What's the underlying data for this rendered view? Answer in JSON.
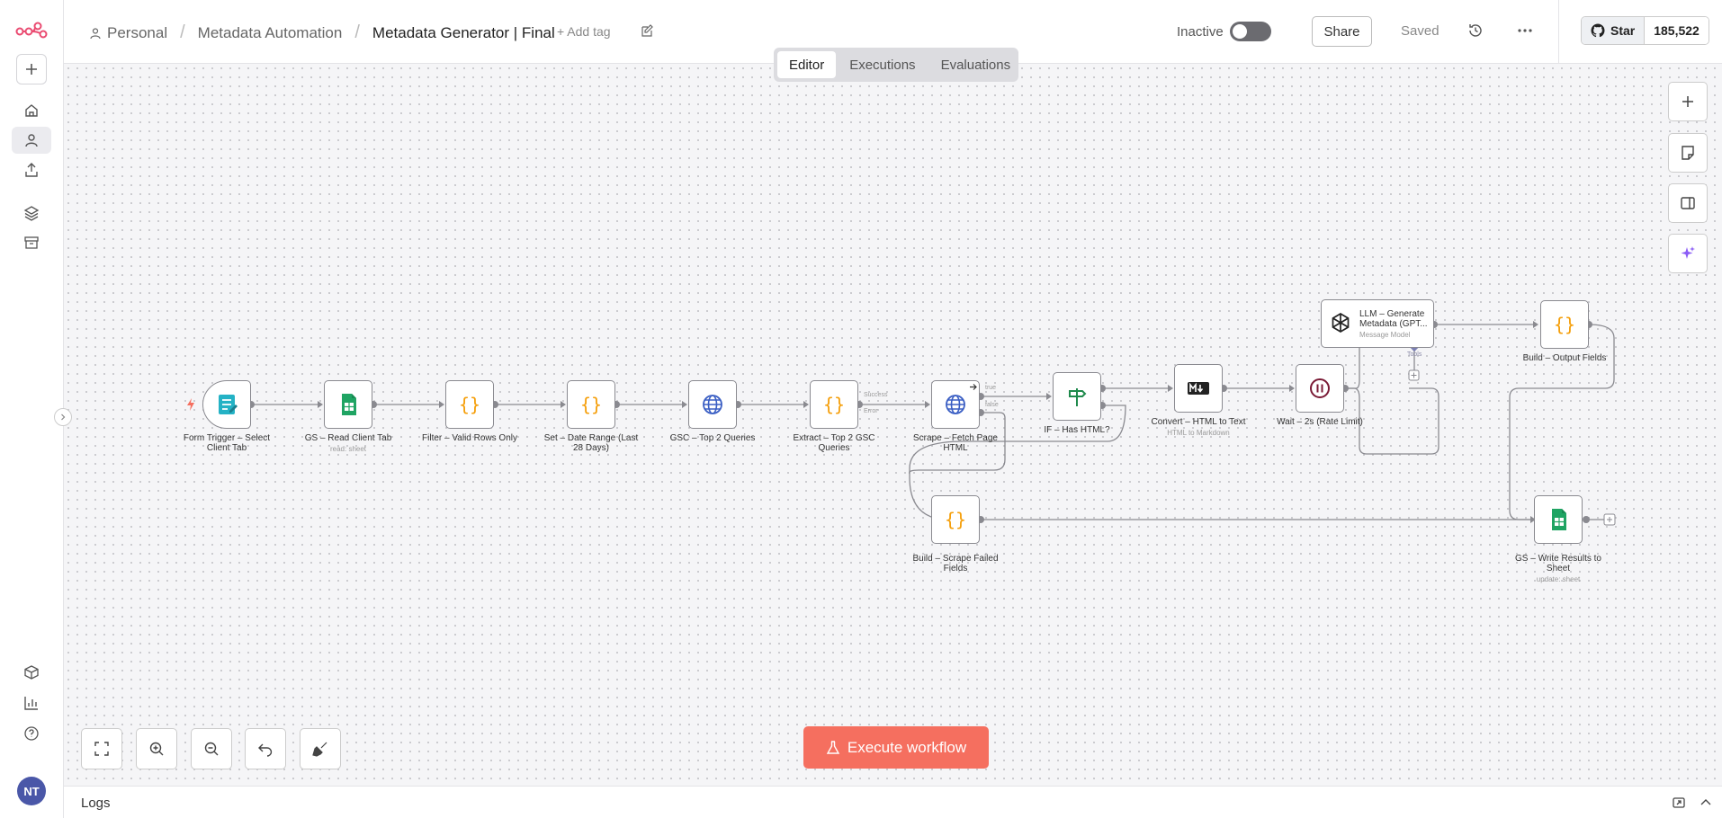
{
  "app": {
    "brand_color": "#ea4b71",
    "accent": "#f56f5f"
  },
  "header": {
    "project": "Personal",
    "folder": "Metadata Automation",
    "workflow_name": "Metadata Generator | Final",
    "add_tag": "+ Add tag",
    "status_label": "Inactive",
    "share": "Share",
    "saved": "Saved",
    "github_star": "Star",
    "github_count": "185,522"
  },
  "tabs": [
    {
      "label": "Editor",
      "active": true
    },
    {
      "label": "Executions",
      "active": false
    },
    {
      "label": "Evaluations",
      "active": false
    }
  ],
  "user": {
    "initials": "NT"
  },
  "nodes": {
    "form_trigger": {
      "label": "Form Trigger – Select Client Tab"
    },
    "gs_read": {
      "label": "GS – Read Client Tab",
      "sub": "read: sheet"
    },
    "filter": {
      "label": "Filter – Valid Rows Only"
    },
    "set_date": {
      "label": "Set – Date Range (Last 28 Days)"
    },
    "gsc": {
      "label": "GSC – Top 2 Queries"
    },
    "extract": {
      "label": "Extract – Top 2 GSC Queries"
    },
    "scrape": {
      "label": "Scrape – Fetch Page HTML",
      "out_success": "Success",
      "out_error": "Error"
    },
    "if_html": {
      "label": "IF – Has HTML?",
      "out_true": "true",
      "out_false": "false"
    },
    "convert": {
      "label": "Convert – HTML to Text",
      "sub": "HTML to Markdown"
    },
    "wait": {
      "label": "Wait – 2s (Rate Limit)"
    },
    "llm": {
      "label": "LLM – Generate Metadata (GPT...",
      "sub": "Message Model",
      "tools": "Tools"
    },
    "build_output": {
      "label": "Build – Output Fields"
    },
    "build_failed": {
      "label": "Build – Scrape Failed Fields"
    },
    "gs_write": {
      "label": "GS – Write Results to Sheet",
      "sub": "update: sheet"
    }
  },
  "canvas": {
    "execute": "Execute workflow"
  },
  "logs": {
    "label": "Logs"
  }
}
